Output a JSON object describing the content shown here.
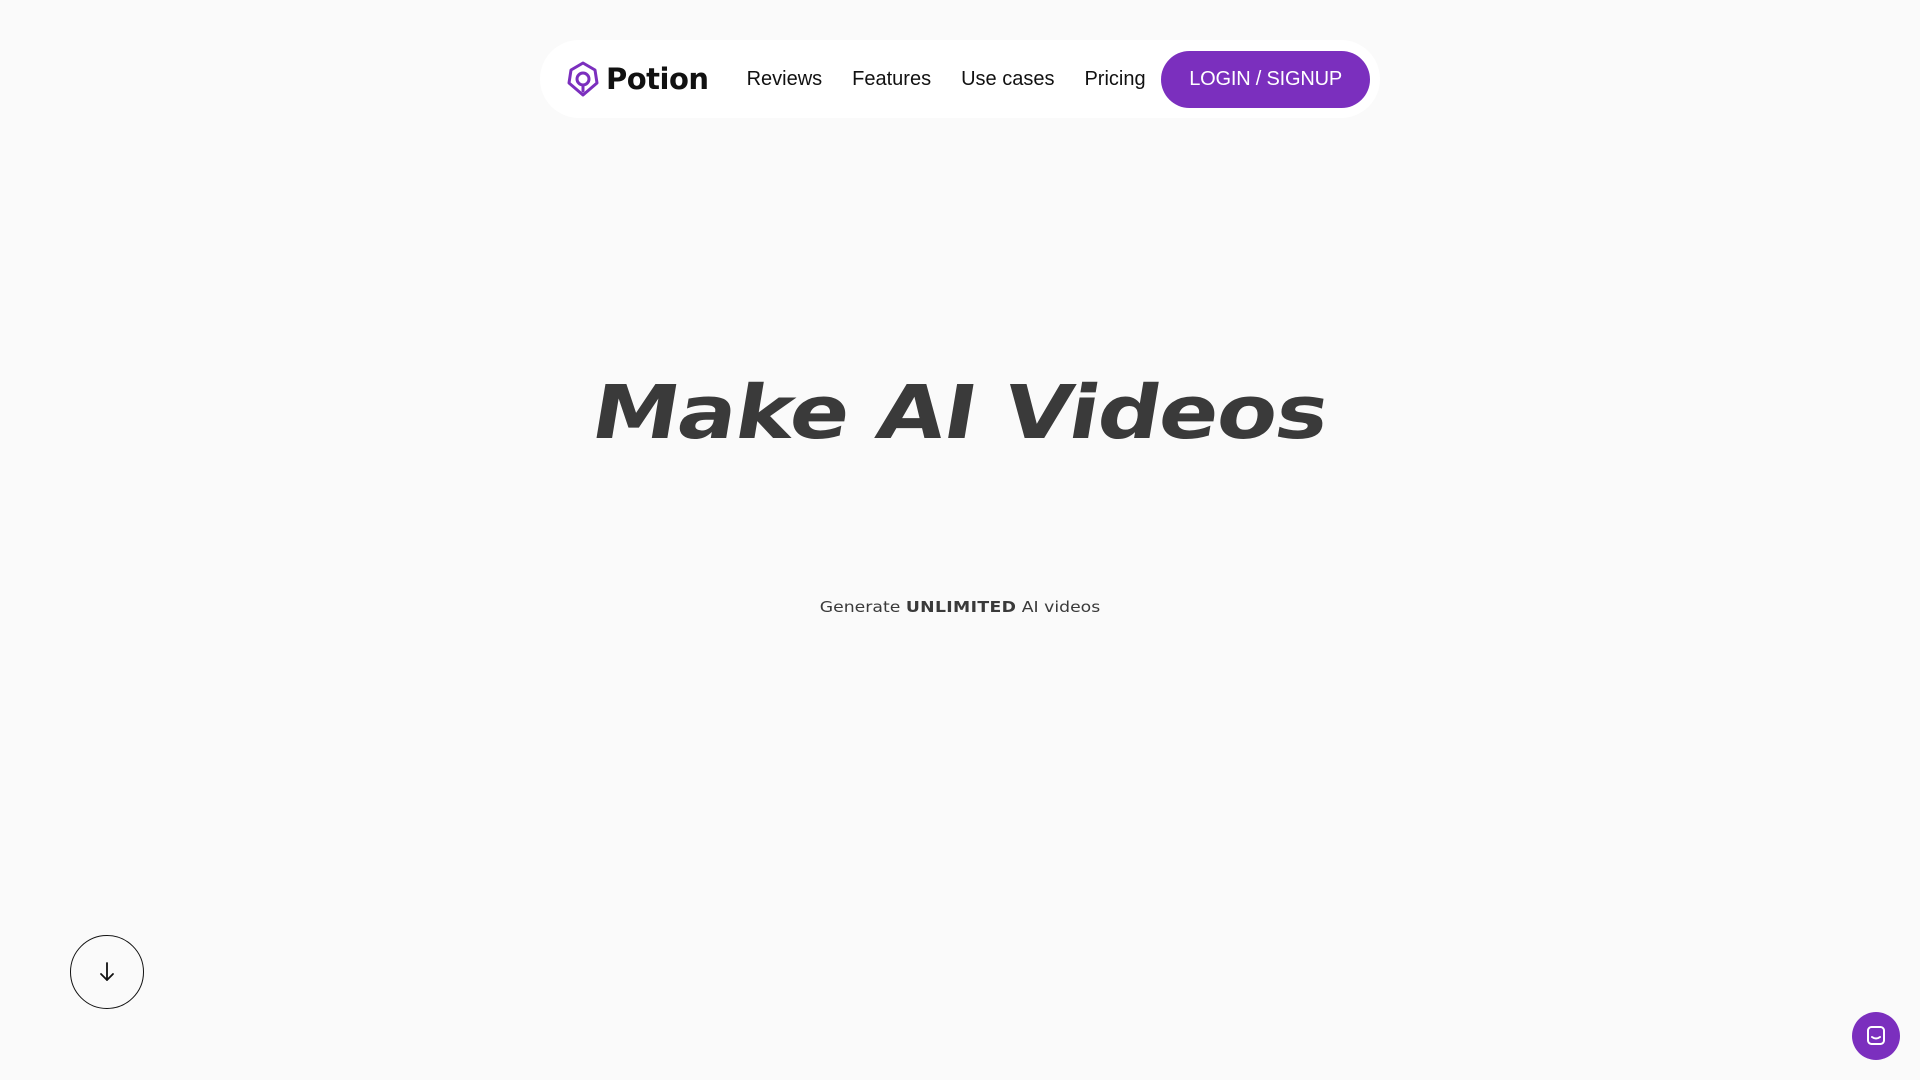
{
  "brand": {
    "name": "Potion",
    "logo_icon": "potion-logo-icon",
    "accent_color": "#7b2fbe"
  },
  "nav": {
    "links": [
      {
        "label": "Reviews"
      },
      {
        "label": "Features"
      },
      {
        "label": "Use cases"
      },
      {
        "label": "Pricing"
      }
    ],
    "cta_label": "LOGIN / SIGNUP"
  },
  "hero": {
    "title": "Make AI Videos",
    "subtitle_prefix": "Generate",
    "subtitle_emphasis": "UNLIMITED",
    "subtitle_suffix": "AI videos"
  },
  "controls": {
    "scroll_icon": "arrow-down-icon",
    "chat_icon": "chat-icon"
  }
}
